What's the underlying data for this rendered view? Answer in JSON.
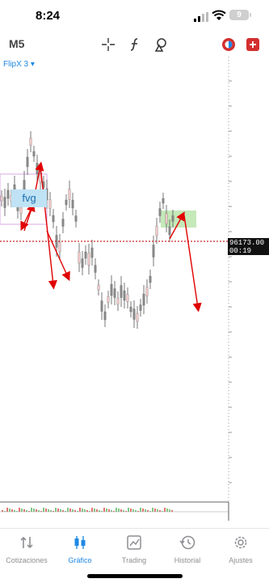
{
  "status": {
    "time": "8:24",
    "battery": "9"
  },
  "toolbar": {
    "timeframe": "M5"
  },
  "chart": {
    "symbol": "FlipX 3",
    "dropdown_glyph": "▾",
    "price": "96173.00",
    "countdown": "00:19",
    "annotation": "fvg",
    "colors": {
      "price_line": "#c62828",
      "arrow": "#e00000",
      "zone_green": "#b7e4a8",
      "zone_blue": "#bfe2f5",
      "candle": "#555555",
      "accent": "#1e88e5"
    }
  },
  "tabs": [
    {
      "label": "Cotizaciones",
      "icon": "quotes-icon"
    },
    {
      "label": "Gráfico",
      "icon": "chart-icon"
    },
    {
      "label": "Trading",
      "icon": "trading-icon"
    },
    {
      "label": "Historial",
      "icon": "history-icon"
    },
    {
      "label": "Ajustes",
      "icon": "settings-icon"
    }
  ]
}
